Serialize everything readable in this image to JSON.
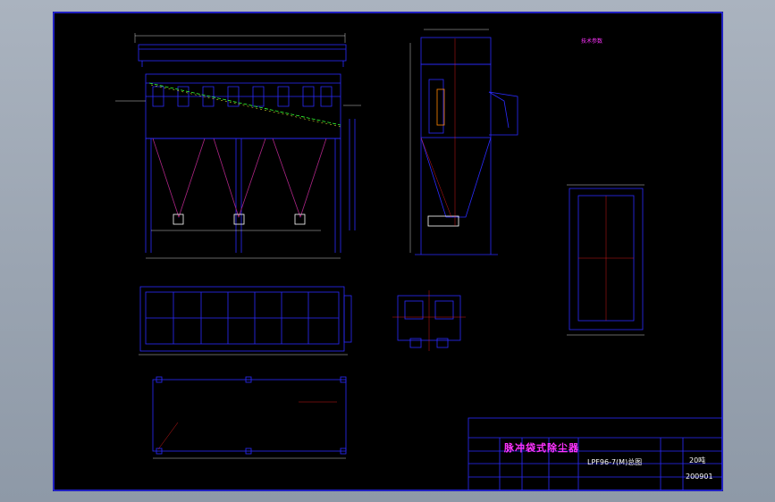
{
  "drawing": {
    "background": "#000000",
    "frame_color": "#2b2bff",
    "line_color": "#2b2bff",
    "text_color": "#ff33ff",
    "dim_color": "#ffffff"
  },
  "title_block": {
    "title": "脉冲袋式除尘器",
    "model": "LPF96-7(M)总图",
    "weight": "20吨",
    "drawing_number": "200901"
  },
  "notes_block": {
    "heading": "技术参数"
  }
}
